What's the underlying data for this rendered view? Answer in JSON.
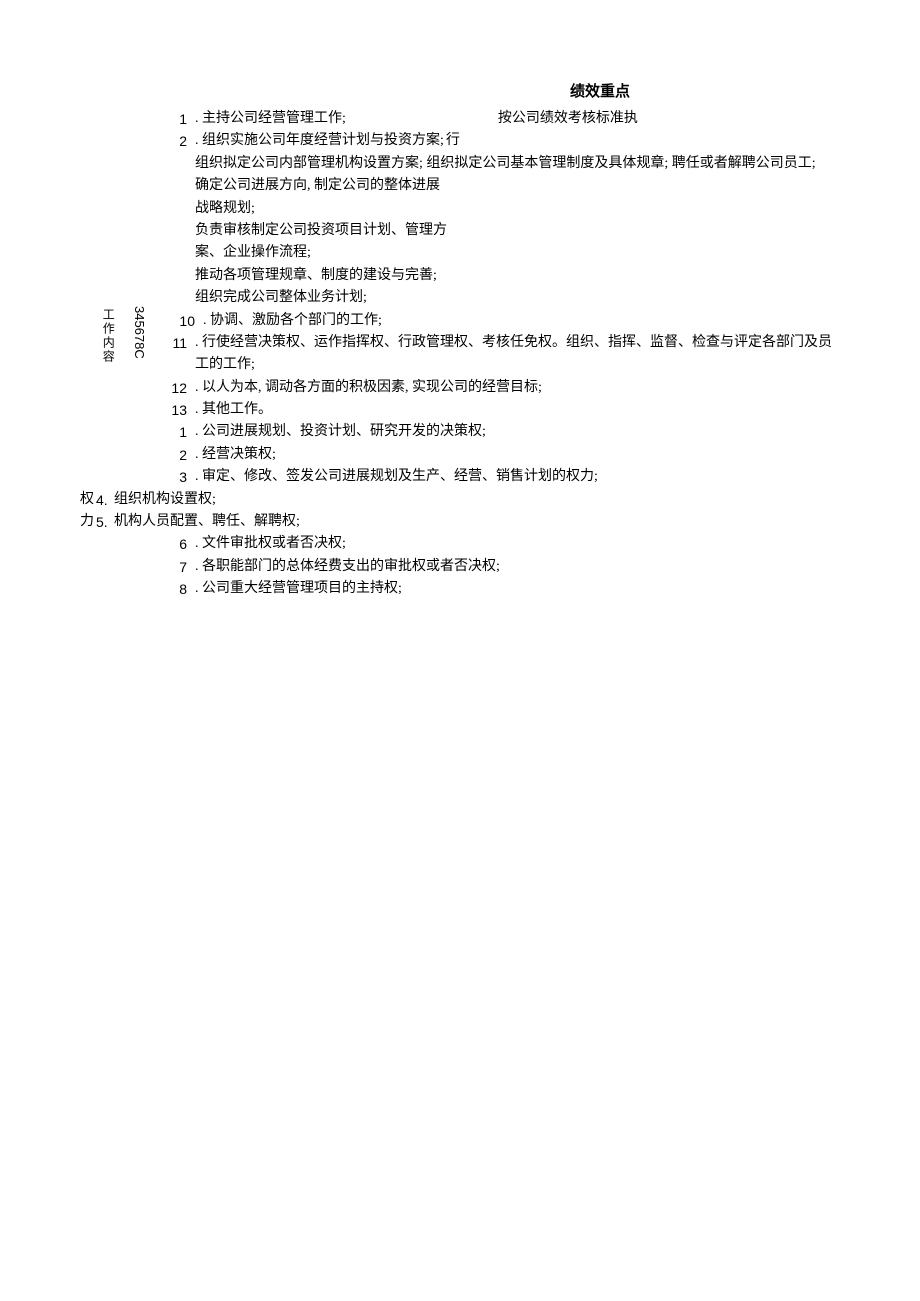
{
  "title": "绩效重点",
  "vertical_label_1": "工作内容",
  "vertical_label_2": "345678C",
  "row1_num": "1",
  "row1_text": ". 主持公司经营管理工作;",
  "row1_right": "按公司绩效考核标准执",
  "row2_num": "2",
  "row2_text": ". 组织实施公司年度经营计划与投资方案;",
  "row2_right": "行",
  "block1_line1": "组织拟定公司内部管理机构设置方案; 组织拟定公司基本管理制度及具体规章; 聘任或者解聘公司员工;",
  "block1_line2": "确定公司进展方向, 制定公司的整体进展",
  "block1_line3": "战略规划;",
  "block1_line4": "负责审核制定公司投资项目计划、管理方",
  "block1_line5": "案、企业操作流程;",
  "block1_line6": "推动各项管理规章、制度的建设与完善;",
  "block1_line7": "组织完成公司整体业务计划;",
  "row10_num": "10",
  "row10_text": ". 协调、激励各个部门的工作;",
  "row11_num": "11",
  "row11_text": ". 行使经营决策权、运作指挥权、行政管理权、考核任免权。组织、指挥、监督、检查与评定各部门及员工的工作;",
  "row12_num": "12",
  "row12_text": ". 以人为本, 调动各方面的积极因素, 实现公司的经营目标;",
  "row13_num": "13",
  "row13_text": ". 其他工作。",
  "auth_row1_num": "1",
  "auth_row1_text": ". 公司进展规划、投资计划、研究开发的决策权;",
  "auth_row2_num": "2",
  "auth_row2_text": ". 经营决策权;",
  "auth_row3_num": "3",
  "auth_row3_text": ". 审定、修改、签发公司进展规划及生产、经营、销售计划的权力;",
  "auth_label_line1": "权",
  "auth_row4_num": "4.",
  "auth_row4_text": "组织机构设置权;",
  "auth_label_line2": "力",
  "auth_row5_num": "5.",
  "auth_row5_text": "机构人员配置、聘任、解聘权;",
  "auth_row6_num": "6",
  "auth_row6_text": ". 文件审批权或者否决权;",
  "auth_row7_num": "7",
  "auth_row7_text": ". 各职能部门的总体经费支出的审批权或者否决权;",
  "auth_row8_num": "8",
  "auth_row8_text": ". 公司重大经营管理项目的主持权;"
}
